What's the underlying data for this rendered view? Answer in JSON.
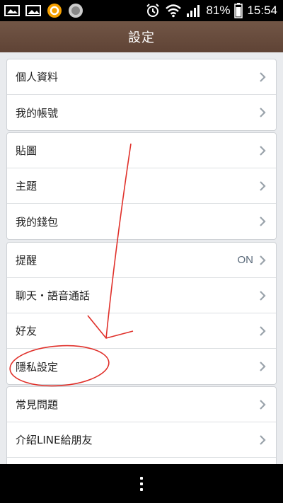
{
  "status_bar": {
    "battery_percent": "81%",
    "time": "15:54",
    "icons": [
      "gallery-icon",
      "picture-icon",
      "orange-app-icon",
      "circle-app-icon",
      "alarm-icon",
      "wifi-icon",
      "signal-icon",
      "battery-icon"
    ]
  },
  "header": {
    "title": "設定"
  },
  "groups": [
    {
      "items": [
        {
          "label": "個人資料"
        },
        {
          "label": "我的帳號"
        }
      ]
    },
    {
      "items": [
        {
          "label": "貼圖"
        },
        {
          "label": "主題"
        },
        {
          "label": "我的錢包"
        }
      ]
    },
    {
      "items": [
        {
          "label": "提醒",
          "status": "ON"
        },
        {
          "label": "聊天・語音通話"
        },
        {
          "label": "好友"
        },
        {
          "label": "隱私設定"
        }
      ]
    },
    {
      "items": [
        {
          "label": "常見問題"
        },
        {
          "label": "介紹LINE給朋友"
        }
      ]
    }
  ],
  "colors": {
    "header": "#654838",
    "background": "#e9ebee",
    "annotation": "#e0302a"
  }
}
